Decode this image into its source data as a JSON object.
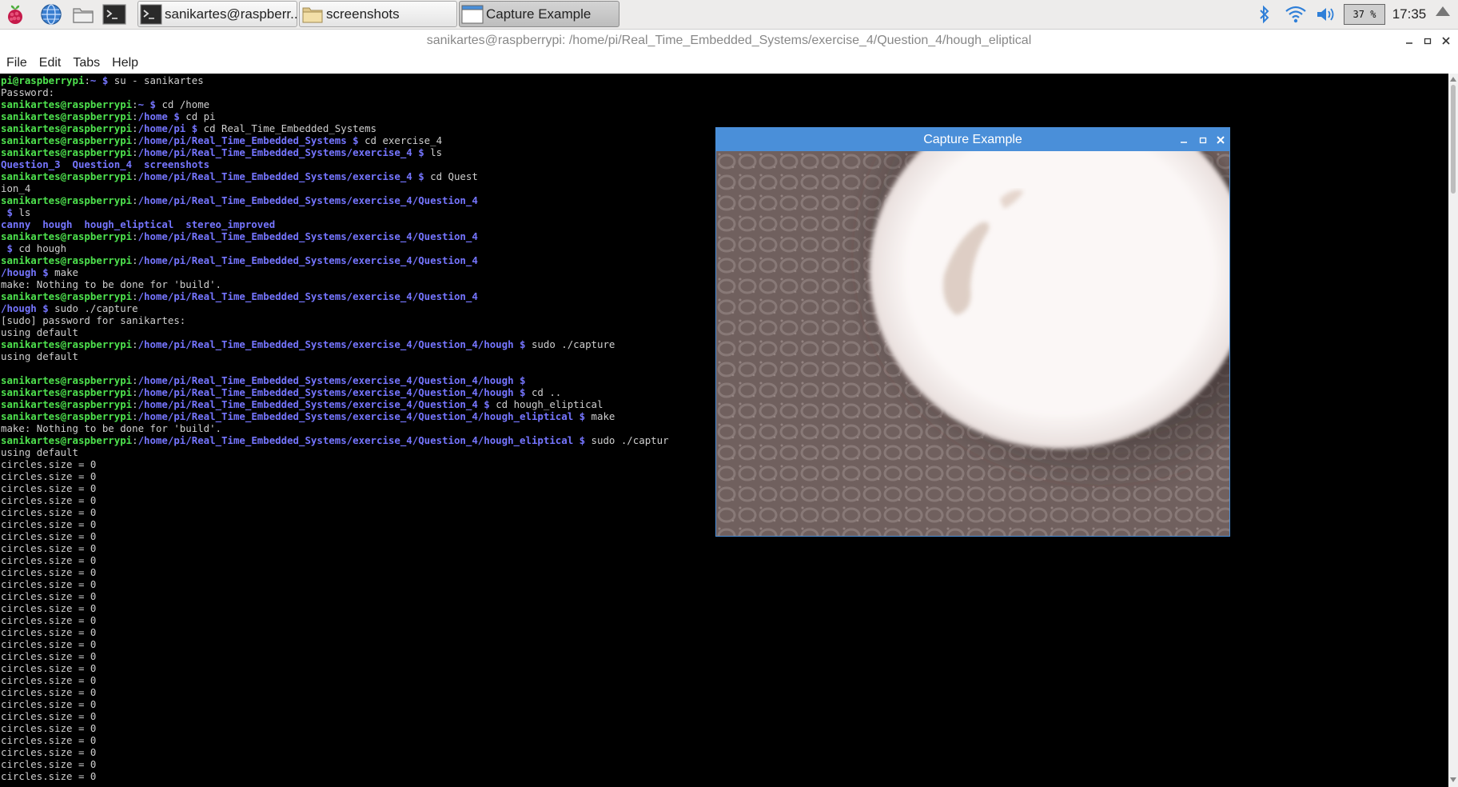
{
  "panel": {
    "taskbar": [
      {
        "label": "sanikartes@raspberr...",
        "icon": "terminal-icon"
      },
      {
        "label": "screenshots",
        "icon": "folder-icon"
      },
      {
        "label": "Capture Example",
        "icon": "window-icon"
      }
    ],
    "cpu_usage": "37 %",
    "clock": "17:35",
    "tray_icons": [
      "bluetooth-icon",
      "wifi-icon",
      "volume-icon",
      "eject-icon"
    ]
  },
  "terminal": {
    "title": "sanikartes@raspberrypi: /home/pi/Real_Time_Embedded_Systems/exercise_4/Question_4/hough_eliptical",
    "menu": [
      "File",
      "Edit",
      "Tabs",
      "Help"
    ],
    "lines": [
      [
        {
          "t": "pi@raspberrypi",
          "c": "u"
        },
        {
          "t": ":"
        },
        {
          "t": "~ $",
          "c": "p"
        },
        {
          "t": " su - sanikartes"
        }
      ],
      [
        {
          "t": "Password:"
        }
      ],
      [
        {
          "t": "sanikartes@raspberrypi",
          "c": "u"
        },
        {
          "t": ":"
        },
        {
          "t": "~ $",
          "c": "p"
        },
        {
          "t": " cd /home"
        }
      ],
      [
        {
          "t": "sanikartes@raspberrypi",
          "c": "u"
        },
        {
          "t": ":"
        },
        {
          "t": "/home $",
          "c": "p"
        },
        {
          "t": " cd pi"
        }
      ],
      [
        {
          "t": "sanikartes@raspberrypi",
          "c": "u"
        },
        {
          "t": ":"
        },
        {
          "t": "/home/pi $",
          "c": "p"
        },
        {
          "t": " cd Real_Time_Embedded_Systems"
        }
      ],
      [
        {
          "t": "sanikartes@raspberrypi",
          "c": "u"
        },
        {
          "t": ":"
        },
        {
          "t": "/home/pi/Real_Time_Embedded_Systems $",
          "c": "p"
        },
        {
          "t": " cd exercise_4"
        }
      ],
      [
        {
          "t": "sanikartes@raspberrypi",
          "c": "u"
        },
        {
          "t": ":"
        },
        {
          "t": "/home/pi/Real_Time_Embedded_Systems/exercise_4 $",
          "c": "p"
        },
        {
          "t": " ls"
        }
      ],
      [
        {
          "t": "Question_3  Question_4  screenshots",
          "c": "l"
        }
      ],
      [
        {
          "t": "sanikartes@raspberrypi",
          "c": "u"
        },
        {
          "t": ":"
        },
        {
          "t": "/home/pi/Real_Time_Embedded_Systems/exercise_4 $",
          "c": "p"
        },
        {
          "t": " cd Quest"
        }
      ],
      [
        {
          "t": "ion_4"
        }
      ],
      [
        {
          "t": "sanikartes@raspberrypi",
          "c": "u"
        },
        {
          "t": ":"
        },
        {
          "t": "/home/pi/Real_Time_Embedded_Systems/exercise_4/Question_4",
          "c": "p"
        }
      ],
      [
        {
          "t": " $",
          "c": "p"
        },
        {
          "t": " ls"
        }
      ],
      [
        {
          "t": "canny  hough  hough_eliptical  stereo_improved",
          "c": "l"
        }
      ],
      [
        {
          "t": "sanikartes@raspberrypi",
          "c": "u"
        },
        {
          "t": ":"
        },
        {
          "t": "/home/pi/Real_Time_Embedded_Systems/exercise_4/Question_4",
          "c": "p"
        }
      ],
      [
        {
          "t": " $",
          "c": "p"
        },
        {
          "t": " cd hough"
        }
      ],
      [
        {
          "t": "sanikartes@raspberrypi",
          "c": "u"
        },
        {
          "t": ":"
        },
        {
          "t": "/home/pi/Real_Time_Embedded_Systems/exercise_4/Question_4",
          "c": "p"
        }
      ],
      [
        {
          "t": "/hough $",
          "c": "p"
        },
        {
          "t": " make"
        }
      ],
      [
        {
          "t": "make: Nothing to be done for 'build'."
        }
      ],
      [
        {
          "t": "sanikartes@raspberrypi",
          "c": "u"
        },
        {
          "t": ":"
        },
        {
          "t": "/home/pi/Real_Time_Embedded_Systems/exercise_4/Question_4",
          "c": "p"
        }
      ],
      [
        {
          "t": "/hough $",
          "c": "p"
        },
        {
          "t": " sudo ./capture"
        }
      ],
      [
        {
          "t": "[sudo] password for sanikartes:"
        }
      ],
      [
        {
          "t": "using default"
        }
      ],
      [
        {
          "t": "sanikartes@raspberrypi",
          "c": "u"
        },
        {
          "t": ":"
        },
        {
          "t": "/home/pi/Real_Time_Embedded_Systems/exercise_4/Question_4/hough $",
          "c": "p"
        },
        {
          "t": " sudo ./capture"
        }
      ],
      [
        {
          "t": "using default"
        }
      ],
      [
        {
          "t": ""
        }
      ],
      [
        {
          "t": "sanikartes@raspberrypi",
          "c": "u"
        },
        {
          "t": ":"
        },
        {
          "t": "/home/pi/Real_Time_Embedded_Systems/exercise_4/Question_4/hough $",
          "c": "p"
        }
      ],
      [
        {
          "t": "sanikartes@raspberrypi",
          "c": "u"
        },
        {
          "t": ":"
        },
        {
          "t": "/home/pi/Real_Time_Embedded_Systems/exercise_4/Question_4/hough $",
          "c": "p"
        },
        {
          "t": " cd .."
        }
      ],
      [
        {
          "t": "sanikartes@raspberrypi",
          "c": "u"
        },
        {
          "t": ":"
        },
        {
          "t": "/home/pi/Real_Time_Embedded_Systems/exercise_4/Question_4 $",
          "c": "p"
        },
        {
          "t": " cd hough_eliptical"
        }
      ],
      [
        {
          "t": "sanikartes@raspberrypi",
          "c": "u"
        },
        {
          "t": ":"
        },
        {
          "t": "/home/pi/Real_Time_Embedded_Systems/exercise_4/Question_4/hough_eliptical $",
          "c": "p"
        },
        {
          "t": " make"
        }
      ],
      [
        {
          "t": "make: Nothing to be done for 'build'."
        }
      ],
      [
        {
          "t": "sanikartes@raspberrypi",
          "c": "u"
        },
        {
          "t": ":"
        },
        {
          "t": "/home/pi/Real_Time_Embedded_Systems/exercise_4/Question_4/hough_eliptical $",
          "c": "p"
        },
        {
          "t": " sudo ./captur"
        }
      ],
      [
        {
          "t": "using default"
        }
      ],
      [
        {
          "t": "circles.size = 0"
        }
      ],
      [
        {
          "t": "circles.size = 0"
        }
      ],
      [
        {
          "t": "circles.size = 0"
        }
      ],
      [
        {
          "t": "circles.size = 0"
        }
      ],
      [
        {
          "t": "circles.size = 0"
        }
      ],
      [
        {
          "t": "circles.size = 0"
        }
      ],
      [
        {
          "t": "circles.size = 0"
        }
      ],
      [
        {
          "t": "circles.size = 0"
        }
      ],
      [
        {
          "t": "circles.size = 0"
        }
      ],
      [
        {
          "t": "circles.size = 0"
        }
      ],
      [
        {
          "t": "circles.size = 0"
        }
      ],
      [
        {
          "t": "circles.size = 0"
        }
      ],
      [
        {
          "t": "circles.size = 0"
        }
      ],
      [
        {
          "t": "circles.size = 0"
        }
      ],
      [
        {
          "t": "circles.size = 0"
        }
      ],
      [
        {
          "t": "circles.size = 0"
        }
      ],
      [
        {
          "t": "circles.size = 0"
        }
      ],
      [
        {
          "t": "circles.size = 0"
        }
      ],
      [
        {
          "t": "circles.size = 0"
        }
      ],
      [
        {
          "t": "circles.size = 0"
        }
      ],
      [
        {
          "t": "circles.size = 0"
        }
      ],
      [
        {
          "t": "circles.size = 0"
        }
      ],
      [
        {
          "t": "circles.size = 0"
        }
      ],
      [
        {
          "t": "circles.size = 0"
        }
      ],
      [
        {
          "t": "circles.size = 0"
        }
      ],
      [
        {
          "t": "circles.size = 0"
        }
      ],
      [
        {
          "t": "circles.size = 0"
        }
      ]
    ]
  },
  "capture_window": {
    "title": "Capture Example"
  },
  "colors": {
    "prompt_user": "#4ee24e",
    "prompt_path": "#7575ff",
    "terminal_text": "#cfcfcf",
    "capture_titlebar": "#4a8fd9"
  }
}
